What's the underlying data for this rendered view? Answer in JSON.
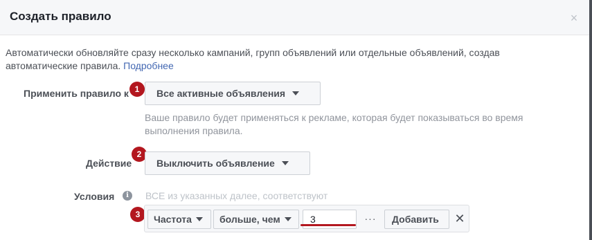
{
  "dialog": {
    "title": "Создать правило",
    "close_symbol": "×"
  },
  "description": {
    "text": "Автоматически обновляйте сразу несколько кампаний, групп объявлений или отдельные объявлений, создав автоматические правила.",
    "link_text": "Подробнее"
  },
  "apply_rule": {
    "label": "Применить правило к",
    "badge": "1",
    "dropdown_value": "Все активные объявления",
    "hint": "Ваше правило будет применяться к рекламе, которая будет показываться во время выполнения правила."
  },
  "action": {
    "label": "Действие",
    "badge": "2",
    "dropdown_value": "Выключить объявление"
  },
  "conditions": {
    "label": "Условия",
    "info_symbol": "i",
    "hint": "ВСЕ из указанных далее, соответствуют",
    "badge": "3",
    "metric": "Частота",
    "operator": "больше, чем",
    "value": "3",
    "more_symbol": "···",
    "add_label": "Добавить",
    "remove_symbol": "✕"
  },
  "colors": {
    "link": "#4267b2",
    "badge": "#b3171f",
    "header_bg": "#f6f7f9"
  },
  "icons": [
    "close-icon",
    "info-icon",
    "caret-down-icon",
    "more-icon",
    "remove-icon"
  ]
}
